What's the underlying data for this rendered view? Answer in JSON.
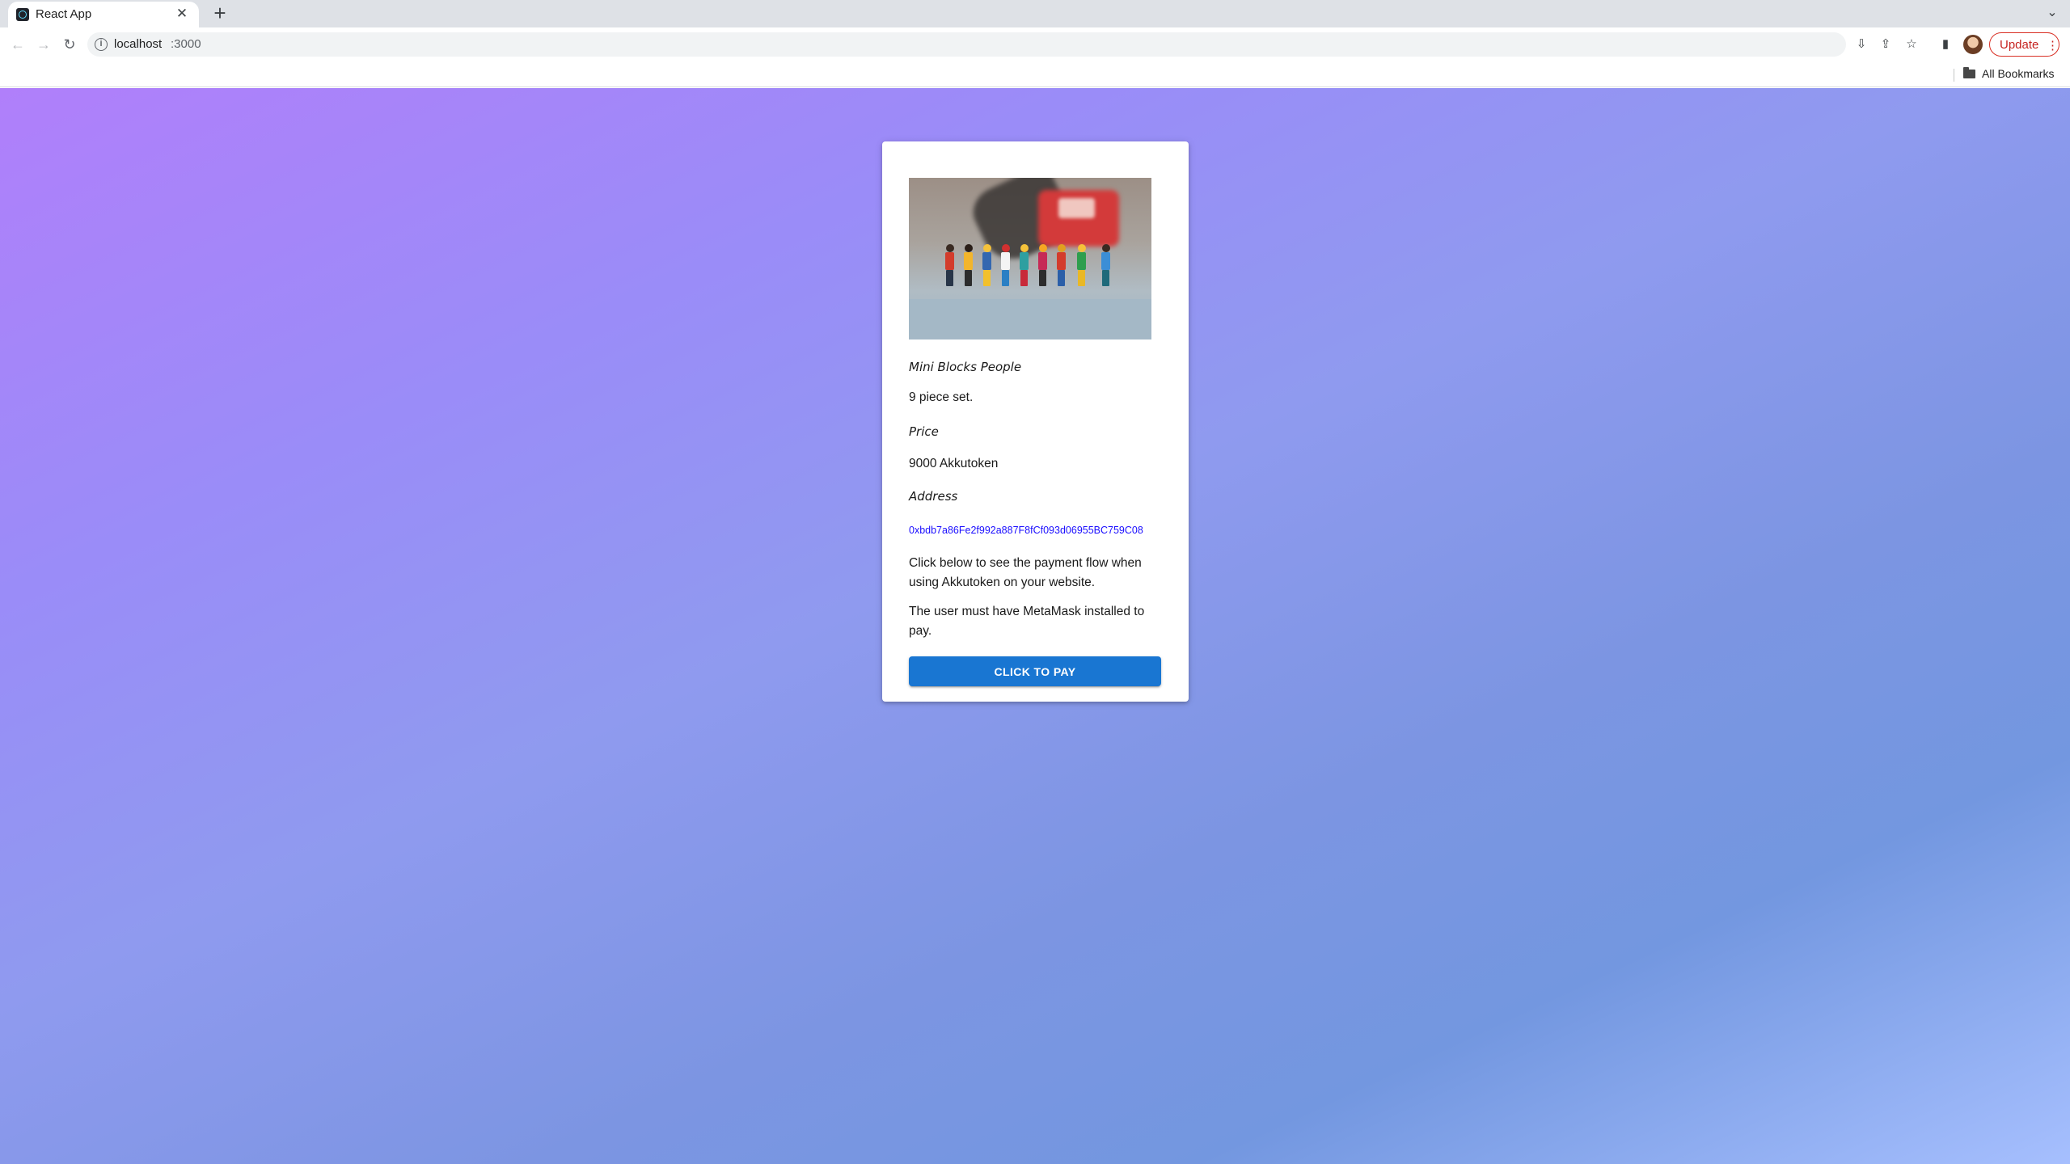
{
  "browser": {
    "tab_title": "React App",
    "tab_close_glyph": "✕",
    "new_tab_glyph": "+",
    "tab_list_glyph": "⌄",
    "back_glyph": "←",
    "forward_glyph": "→",
    "reload_glyph": "↻",
    "site_info_glyph": "i",
    "url_host": "localhost",
    "url_port": ":3000",
    "install_glyph": "⇩",
    "share_glyph": "⇪",
    "bookmark_glyph": "☆",
    "side_panel_glyph": "▮",
    "update_label": "Update",
    "menu_glyph": "⋮",
    "all_bookmarks_label": "All Bookmarks"
  },
  "product": {
    "name": "Mini Blocks People",
    "description": "9 piece set.",
    "price_label": "Price",
    "price_value": "9000 Akkutoken",
    "address_label": "Address",
    "address_value": "0xbdb7a86Fe2f992a887F8fCf093d06955BC759C08",
    "info_line_1": "Click below to see the payment flow when using Akkutoken on your website.",
    "info_line_2": "The user must have MetaMask installed to pay.",
    "pay_button_label": "CLICK TO PAY"
  },
  "colors": {
    "accent": "#1976d2",
    "address_link": "#1a0dff",
    "update_red": "#c5221f",
    "background_gradient_start": "#b07ffa",
    "background_gradient_end": "#a6bffe"
  }
}
